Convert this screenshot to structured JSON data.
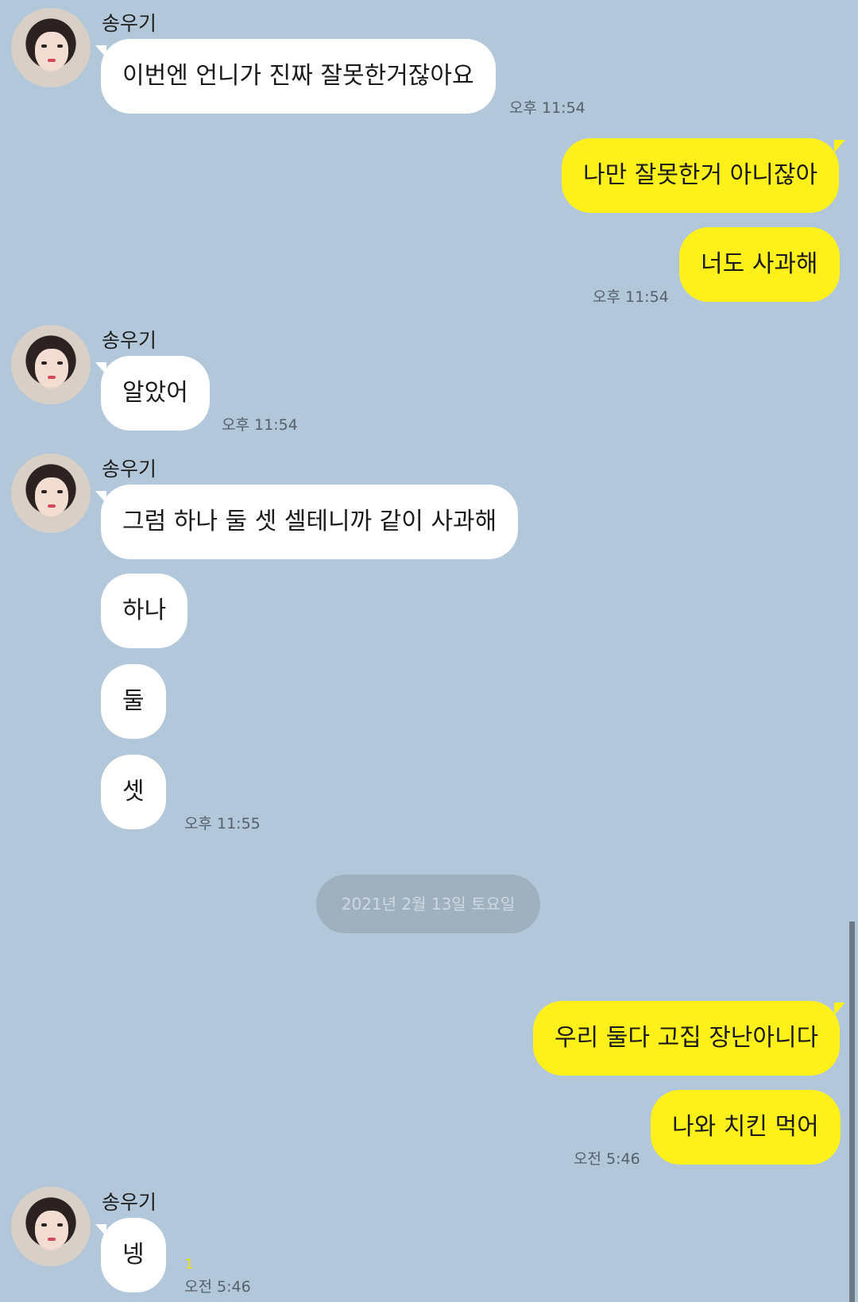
{
  "chat": {
    "messages": [
      {
        "sender": "송우기",
        "text": "이번엔 언니가 진짜 잘못한거잖아요",
        "time": "오후 11:54"
      },
      {
        "text": "나만 잘못한거 아니잖아"
      },
      {
        "text": "너도 사과해",
        "time": "오후 11:54"
      },
      {
        "sender": "송우기",
        "text": "알았어",
        "time": "오후 11:54"
      },
      {
        "sender": "송우기",
        "text": "그럼 하나 둘 셋 셀테니까 같이 사과해"
      },
      {
        "text": "하나"
      },
      {
        "text": "둘"
      },
      {
        "text": "셋",
        "time": "오후 11:55"
      },
      {
        "text": "우리 둘다 고집 장난아니다"
      },
      {
        "text": "나와 치킨 먹어",
        "time": "오전 5:46"
      },
      {
        "sender": "송우기",
        "text": "넹",
        "unread": "1",
        "time": "오전 5:46"
      }
    ],
    "date_divider": "2021년 2월 13일 토요일"
  },
  "colors": {
    "background": "#b2c7da",
    "incoming_bubble": "#ffffff",
    "outgoing_bubble": "#fef01b",
    "date_pill": "#9fb0bf"
  }
}
